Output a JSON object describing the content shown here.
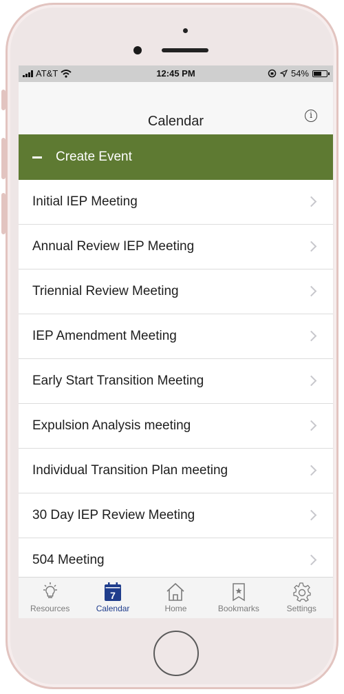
{
  "status_bar": {
    "carrier": "AT&T",
    "time": "12:45 PM",
    "battery_percent": "54%"
  },
  "nav": {
    "title": "Calendar",
    "info_icon": "info-circle-icon"
  },
  "create_event": {
    "label": "Create Event"
  },
  "events": [
    {
      "label": "Initial IEP Meeting"
    },
    {
      "label": "Annual Review IEP Meeting"
    },
    {
      "label": "Triennial Review Meeting"
    },
    {
      "label": "IEP Amendment Meeting"
    },
    {
      "label": "Early Start Transition Meeting"
    },
    {
      "label": "Expulsion Analysis meeting"
    },
    {
      "label": "Individual Transition Plan meeting"
    },
    {
      "label": "30 Day IEP Review Meeting"
    },
    {
      "label": "504 Meeting"
    }
  ],
  "tabs": [
    {
      "label": "Resources",
      "icon": "lightbulb-icon"
    },
    {
      "label": "Calendar",
      "icon": "calendar-icon",
      "badge": "7",
      "active": true
    },
    {
      "label": "Home",
      "icon": "home-icon"
    },
    {
      "label": "Bookmarks",
      "icon": "bookmark-icon"
    },
    {
      "label": "Settings",
      "icon": "gear-icon"
    }
  ],
  "colors": {
    "header_green": "#5e7a32",
    "active_tab": "#1f3d8c"
  }
}
